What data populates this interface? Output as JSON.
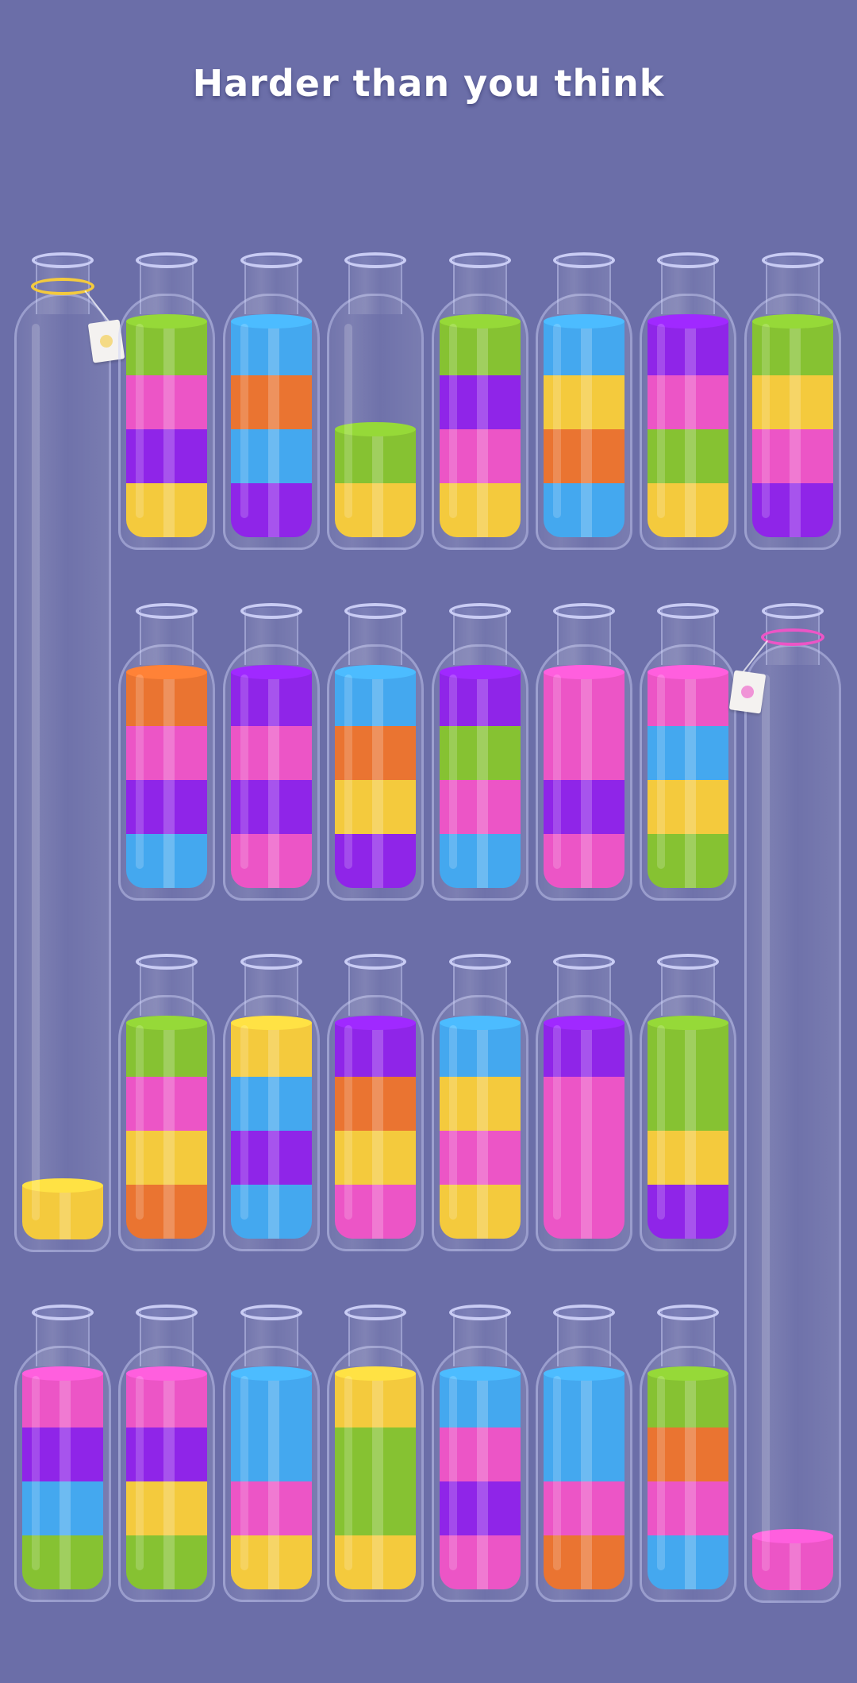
{
  "title": "Harder than you think",
  "colors": {
    "background": "#6b6ea8",
    "green": "#86c232",
    "pink": "#ec55c6",
    "purple": "#8f25e8",
    "yellow": "#f4ca3d",
    "blue": "#44a8ef",
    "orange": "#ea7431",
    "tube_rim": "#c9ccf4"
  },
  "tubes": [
    {
      "id": "tube-r1-c1",
      "layers": [
        "yellow"
      ],
      "tall": true,
      "tag": {
        "color": "yellow"
      }
    },
    {
      "id": "tube-r1-c2",
      "layers": [
        "green",
        "pink",
        "purple",
        "yellow"
      ]
    },
    {
      "id": "tube-r1-c3",
      "layers": [
        "blue",
        "orange",
        "blue",
        "purple"
      ]
    },
    {
      "id": "tube-r1-c4",
      "layers": [
        "green",
        "yellow"
      ]
    },
    {
      "id": "tube-r1-c5",
      "layers": [
        "green",
        "purple",
        "pink",
        "yellow"
      ]
    },
    {
      "id": "tube-r1-c6",
      "layers": [
        "blue",
        "yellow",
        "orange",
        "blue"
      ]
    },
    {
      "id": "tube-r1-c7",
      "layers": [
        "purple",
        "pink",
        "green",
        "yellow"
      ]
    },
    {
      "id": "tube-r1-c8",
      "layers": [
        "green",
        "yellow",
        "pink",
        "purple"
      ]
    },
    {
      "id": "tube-r2-c2",
      "layers": [
        "orange",
        "pink",
        "purple",
        "blue"
      ]
    },
    {
      "id": "tube-r2-c3",
      "layers": [
        "purple",
        "pink",
        "purple",
        "pink"
      ]
    },
    {
      "id": "tube-r2-c4",
      "layers": [
        "blue",
        "orange",
        "yellow",
        "purple"
      ]
    },
    {
      "id": "tube-r2-c5",
      "layers": [
        "purple",
        "green",
        "pink",
        "blue"
      ]
    },
    {
      "id": "tube-r2-c6",
      "layers": [
        "pink",
        "pink",
        "purple",
        "pink"
      ]
    },
    {
      "id": "tube-r2-c7",
      "layers": [
        "pink",
        "blue",
        "yellow",
        "green"
      ]
    },
    {
      "id": "tube-r2-c8",
      "layers": [
        "pink"
      ],
      "tall": true,
      "tag": {
        "color": "pink"
      }
    },
    {
      "id": "tube-r3-c2",
      "layers": [
        "green",
        "pink",
        "yellow",
        "orange"
      ]
    },
    {
      "id": "tube-r3-c3",
      "layers": [
        "yellow",
        "blue",
        "purple",
        "blue"
      ]
    },
    {
      "id": "tube-r3-c4",
      "layers": [
        "purple",
        "orange",
        "yellow",
        "pink"
      ]
    },
    {
      "id": "tube-r3-c5",
      "layers": [
        "blue",
        "yellow",
        "pink",
        "yellow"
      ]
    },
    {
      "id": "tube-r3-c6",
      "layers": [
        "purple",
        "pink",
        "pink",
        "pink"
      ]
    },
    {
      "id": "tube-r3-c7",
      "layers": [
        "green",
        "green",
        "yellow",
        "purple"
      ]
    },
    {
      "id": "tube-r4-c1",
      "layers": [
        "pink",
        "purple",
        "blue",
        "green"
      ]
    },
    {
      "id": "tube-r4-c2",
      "layers": [
        "pink",
        "purple",
        "yellow",
        "green"
      ]
    },
    {
      "id": "tube-r4-c3",
      "layers": [
        "blue",
        "blue",
        "pink",
        "yellow"
      ]
    },
    {
      "id": "tube-r4-c4",
      "layers": [
        "yellow",
        "green",
        "green",
        "yellow"
      ]
    },
    {
      "id": "tube-r4-c5",
      "layers": [
        "blue",
        "pink",
        "purple",
        "pink"
      ]
    },
    {
      "id": "tube-r4-c6",
      "layers": [
        "blue",
        "blue",
        "pink",
        "orange"
      ]
    },
    {
      "id": "tube-r4-c7",
      "layers": [
        "green",
        "orange",
        "pink",
        "blue"
      ]
    }
  ]
}
